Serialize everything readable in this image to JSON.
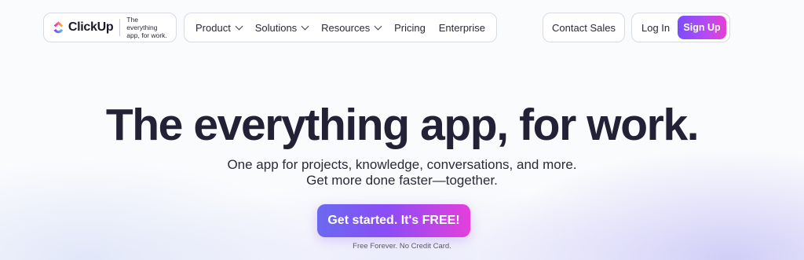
{
  "brand": {
    "name": "ClickUp",
    "tagline_line1": "The everything",
    "tagline_line2": "app, for work.",
    "colors": {
      "purple": "#7b4dff",
      "pink": "#e83fd4",
      "orange": "#ff8a3d",
      "blue": "#49ccf9"
    }
  },
  "nav": {
    "items": [
      {
        "label": "Product",
        "has_dropdown": true
      },
      {
        "label": "Solutions",
        "has_dropdown": true
      },
      {
        "label": "Resources",
        "has_dropdown": true
      },
      {
        "label": "Pricing",
        "has_dropdown": false
      },
      {
        "label": "Enterprise",
        "has_dropdown": false
      }
    ],
    "contact_sales": "Contact Sales",
    "log_in": "Log In",
    "sign_up": "Sign Up"
  },
  "hero": {
    "title": "The everything app, for work.",
    "subtitle_line1": "One app for projects, knowledge, conversations, and more.",
    "subtitle_line2": "Get more done faster—together.",
    "cta_label": "Get started. It's FREE!",
    "fine_print": "Free Forever. No Credit Card."
  }
}
